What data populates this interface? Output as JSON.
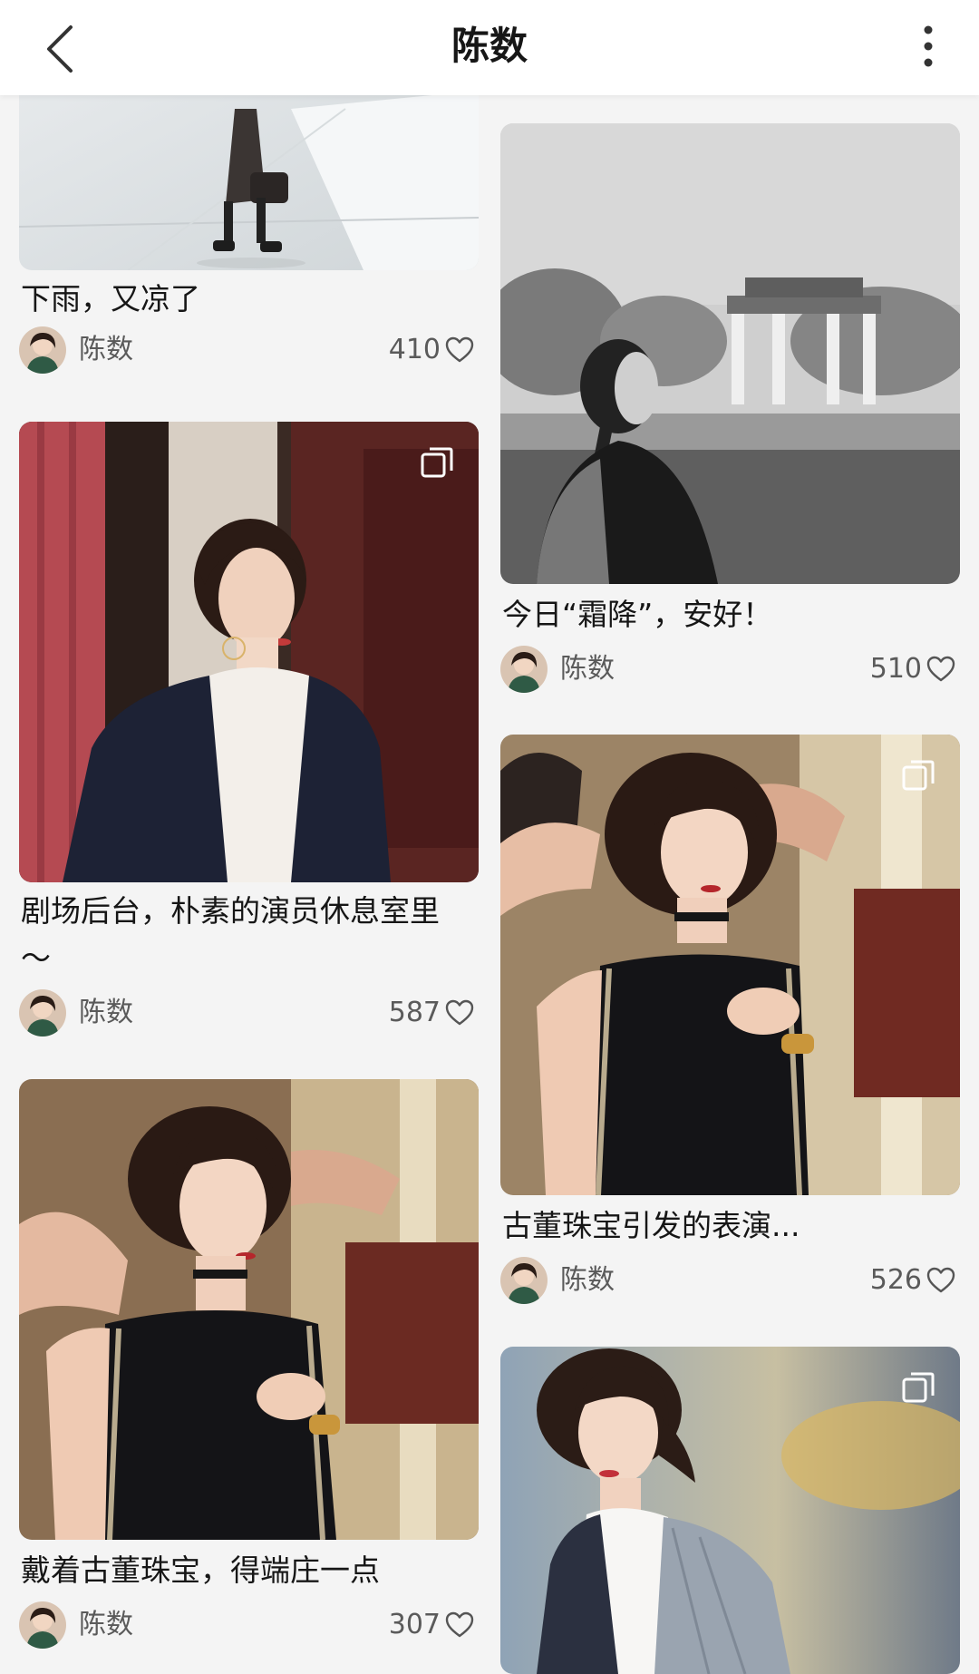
{
  "header": {
    "title": "陈数",
    "back_icon": "chevron-left-icon",
    "more_icon": "more-vertical-icon"
  },
  "posts": [
    {
      "caption": "下雨，又凉了",
      "author": "陈数",
      "likes": "410",
      "multi_image": false,
      "column": "left"
    },
    {
      "caption": "剧场后台，朴素的演员休息室里～",
      "author": "陈数",
      "likes": "587",
      "multi_image": true,
      "column": "left"
    },
    {
      "caption": "戴着古董珠宝，得端庄一点",
      "author": "陈数",
      "likes": "307",
      "multi_image": false,
      "column": "left"
    },
    {
      "caption": "今日“霜降”，安好！",
      "author": "陈数",
      "likes": "510",
      "multi_image": false,
      "column": "right"
    },
    {
      "caption": "古董珠宝引发的表演...",
      "author": "陈数",
      "likes": "526",
      "multi_image": true,
      "column": "right"
    },
    {
      "caption": "",
      "author": "",
      "likes": "",
      "multi_image": true,
      "column": "right"
    }
  ],
  "colors": {
    "background": "#f4f4f4",
    "header_bg": "#ffffff",
    "text_primary": "#161616",
    "text_secondary": "#5a5a5a"
  }
}
